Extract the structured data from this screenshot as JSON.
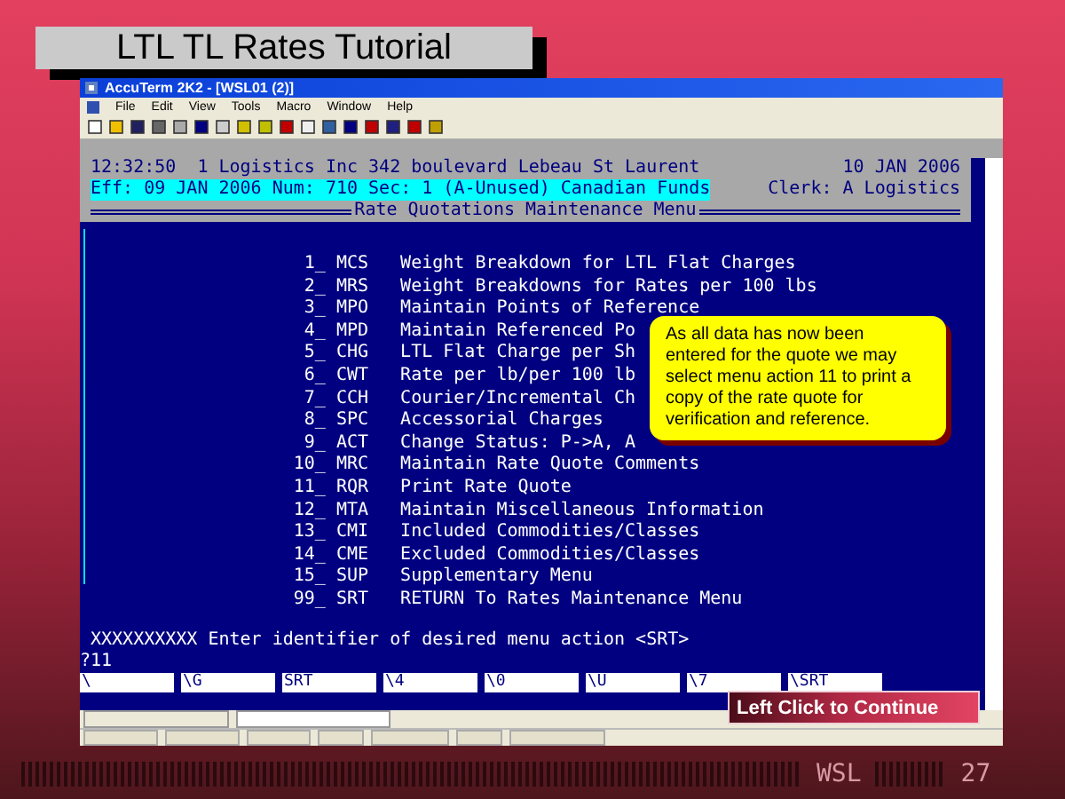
{
  "slide_title": "LTL TL Rates Tutorial",
  "window": {
    "title": "AccuTerm 2K2 - [WSL01 (2)]",
    "menu": [
      "File",
      "Edit",
      "View",
      "Tools",
      "Macro",
      "Window",
      "Help"
    ]
  },
  "terminal": {
    "header_left": "12:32:50  1 Logistics Inc 342 boulevard Lebeau St Laurent",
    "header_date": "10 JAN 2006",
    "status": "Eff: 09 JAN 2006 Num: 710 Sec: 1 (A-Unused) Canadian Funds",
    "clerk": "Clerk: A Logistics",
    "menu_title": "Rate Quotations Maintenance Menu",
    "items": [
      {
        "number": "1_",
        "code": "MCS",
        "label": "Weight Breakdown for LTL Flat Charges"
      },
      {
        "number": "2_",
        "code": "MRS",
        "label": "Weight Breakdowns for Rates per 100 lbs"
      },
      {
        "number": "3_",
        "code": "MPO",
        "label": "Maintain Points of Reference"
      },
      {
        "number": "4_",
        "code": "MPD",
        "label": "Maintain Referenced Po"
      },
      {
        "number": "5_",
        "code": "CHG",
        "label": "LTL Flat Charge per Sh"
      },
      {
        "number": "6_",
        "code": "CWT",
        "label": "Rate per lb/per 100 lb"
      },
      {
        "number": "7_",
        "code": "CCH",
        "label": "Courier/Incremental Ch"
      },
      {
        "number": "8_",
        "code": "SPC",
        "label": "Accessorial Charges"
      },
      {
        "number": "9_",
        "code": "ACT",
        "label": "Change Status: P->A, A"
      },
      {
        "number": "10_",
        "code": "MRC",
        "label": "Maintain Rate Quote Comments"
      },
      {
        "number": "11_",
        "code": "RQR",
        "label": "Print Rate Quote"
      },
      {
        "number": "12_",
        "code": "MTA",
        "label": "Maintain Miscellaneous Information"
      },
      {
        "number": "13_",
        "code": "CMI",
        "label": "Included Commodities/Classes"
      },
      {
        "number": "14_",
        "code": "CME",
        "label": "Excluded Commodities/Classes"
      },
      {
        "number": "15_",
        "code": "SUP",
        "label": "Supplementary Menu"
      },
      {
        "number": "99_",
        "code": "SRT",
        "label": "RETURN To Rates Maintenance Menu"
      }
    ],
    "prompt": "XXXXXXXXXX Enter identifier of desired menu action <SRT>",
    "input": "?11",
    "function_keys": [
      "\\",
      "\\G",
      "SRT",
      "\\4",
      "\\0",
      "\\U",
      "\\7",
      "\\SRT"
    ]
  },
  "callout": "As all data has now been entered for the quote we may select menu action 11 to print a copy of the rate quote for verification and reference.",
  "continue_button": "Left Click to Continue",
  "footer": {
    "left": "WSL",
    "page": "27"
  }
}
